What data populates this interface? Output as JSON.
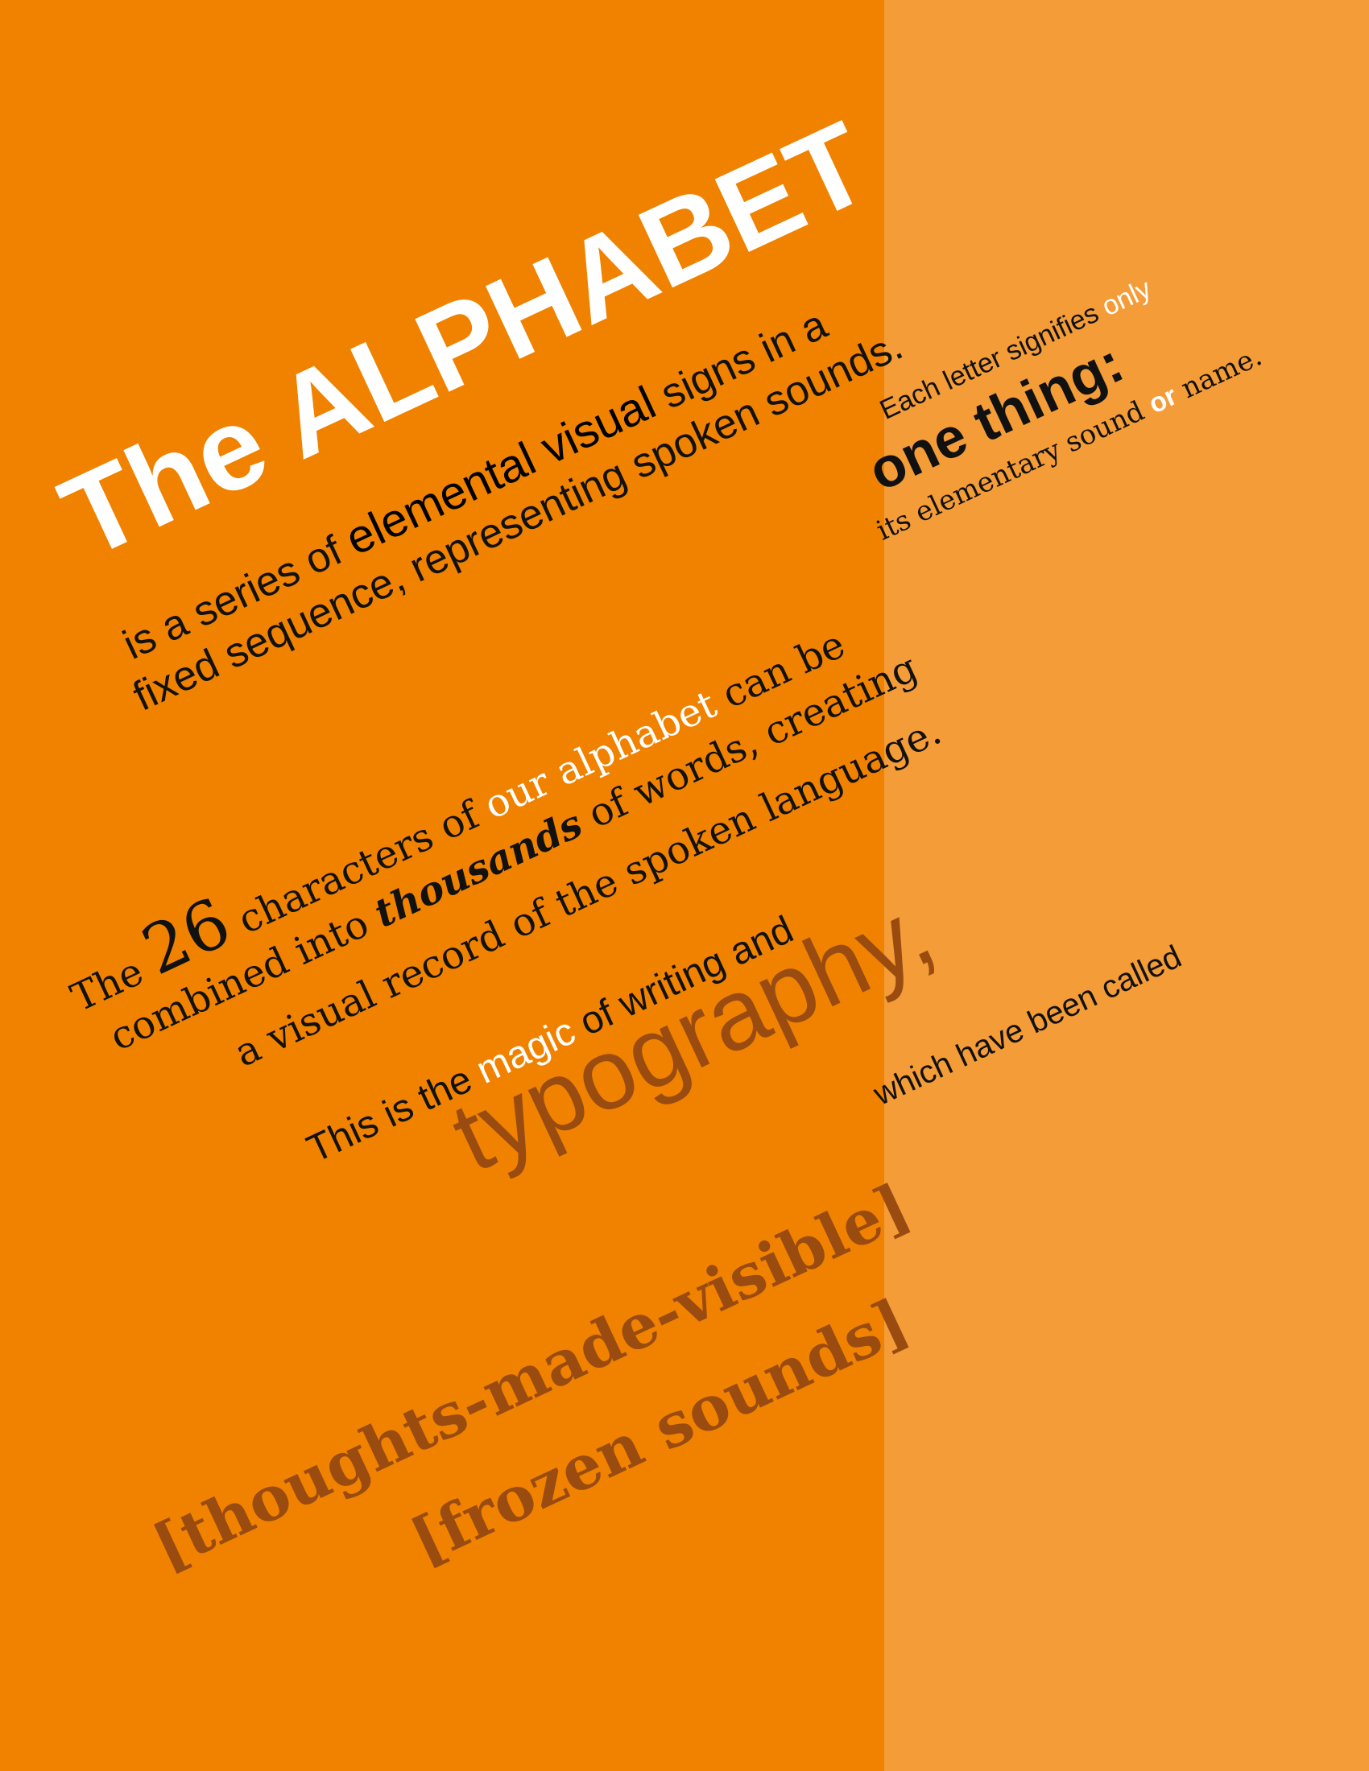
{
  "colors": {
    "left_panel": "#f08200",
    "right_panel": "#f49c37",
    "accent_brown": "#9a4b10",
    "white": "#ffffff",
    "black": "#111111"
  },
  "title": {
    "pre": "The ",
    "main": "ALPHABET"
  },
  "intro": {
    "l1a": "is a series of ",
    "l1b": "elemental visual",
    "l1c": " signs in a",
    "l2": "fixed sequence, representing spoken sounds."
  },
  "side": {
    "l1a": "Each letter signifies ",
    "l1b": "only",
    "l2": "one thing:",
    "l3a": "its elementary sound ",
    "l3b": "or",
    "l3c": " name."
  },
  "para": {
    "l1a": "The ",
    "l1b": "26",
    "l1c": " characters of ",
    "l1d": "our alphabet",
    "l1e": " can be",
    "l2a": "combined into ",
    "l2b": "thousands",
    "l2c": " of words, creating",
    "l3": "a visual record of the spoken language."
  },
  "magic": {
    "a": "This is the ",
    "b": "magic",
    "c": " of writing and",
    "typo": "typography,",
    "called": "which have been called"
  },
  "brackets": {
    "l1": "[thoughts-made-visible]",
    "l2": "[frozen sounds]"
  }
}
